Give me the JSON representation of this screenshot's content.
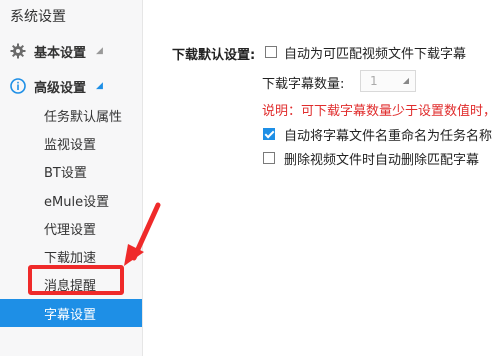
{
  "app": {
    "title": "系统设置"
  },
  "sidebar": {
    "groups": [
      {
        "label": "基本设置",
        "icon": "gear-icon"
      },
      {
        "label": "高级设置",
        "icon": "info-icon"
      }
    ],
    "items": [
      {
        "label": "任务默认属性"
      },
      {
        "label": "监视设置"
      },
      {
        "label": "BT设置"
      },
      {
        "label": "eMule设置"
      },
      {
        "label": "代理设置"
      },
      {
        "label": "下载加速"
      },
      {
        "label": "消息提醒"
      },
      {
        "label": "字幕设置"
      }
    ],
    "active_index": 7
  },
  "annotation": {
    "color": "#ef2a2a",
    "target": "消息提醒"
  },
  "main": {
    "section_label": "下载默认设置:",
    "options": [
      {
        "label": "自动为可匹配视频文件下载字幕",
        "checked": false
      },
      {
        "label": "自动将字幕文件名重命名为任务名称",
        "checked": true
      },
      {
        "label": "删除视频文件时自动删除匹配字幕",
        "checked": false
      }
    ],
    "count": {
      "label": "下载字幕数量:",
      "value": "1"
    },
    "note": "说明：可下载字幕数量少于设置数值时，"
  },
  "colors": {
    "accent": "#1e8fe6",
    "warning": "#e02d2d"
  }
}
